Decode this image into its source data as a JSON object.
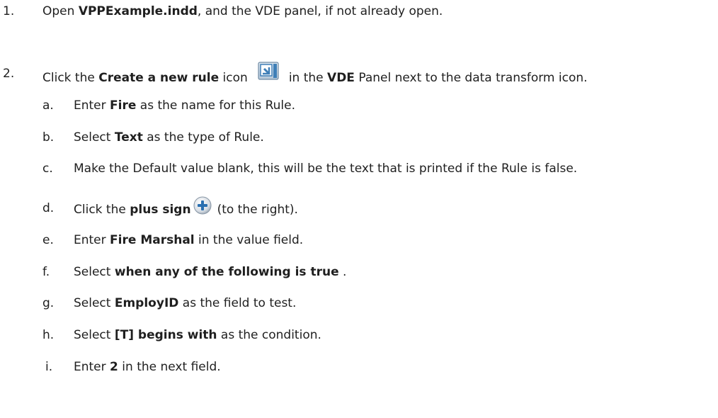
{
  "steps": [
    {
      "number": "1.",
      "parts": [
        "Open ",
        "VPPExample.indd",
        ", and the VDE panel, if not already open."
      ]
    },
    {
      "number": "2.",
      "parts": [
        "Click the ",
        "Create a new rule",
        " icon",
        "in the ",
        "VDE",
        " Panel next to the data transform icon."
      ],
      "icon": "create-rule-icon",
      "substeps": [
        {
          "letter": "a.",
          "parts": [
            "Enter ",
            "Fire",
            " as the name for this Rule."
          ]
        },
        {
          "letter": "b.",
          "parts": [
            "Select ",
            "Text",
            " as the type of Rule."
          ]
        },
        {
          "letter": "c.",
          "parts": [
            "Make the Default value blank, this will be the text that is printed if the Rule is false."
          ]
        },
        {
          "letter": "d.",
          "parts": [
            "Click the ",
            "plus sign",
            "(to the right)."
          ],
          "icon": "plus-sign-icon"
        },
        {
          "letter": "e.",
          "parts": [
            "Enter ",
            "Fire Marshal",
            " in the value field."
          ]
        },
        {
          "letter": "f.",
          "parts": [
            "Select ",
            "when any of the following is true",
            " ."
          ]
        },
        {
          "letter": "g.",
          "parts": [
            "Select ",
            "EmployID",
            " as the field to test."
          ]
        },
        {
          "letter": "h.",
          "parts": [
            "Select ",
            "[T] begins with",
            " as the condition."
          ]
        },
        {
          "letter": "i.",
          "parts": [
            "Enter ",
            "2",
            " in the next field."
          ]
        }
      ]
    }
  ],
  "colors": {
    "text": "#1f1f1f",
    "icon_blue": "#3f7fb7",
    "plus_blue": "#2a6fb0"
  }
}
